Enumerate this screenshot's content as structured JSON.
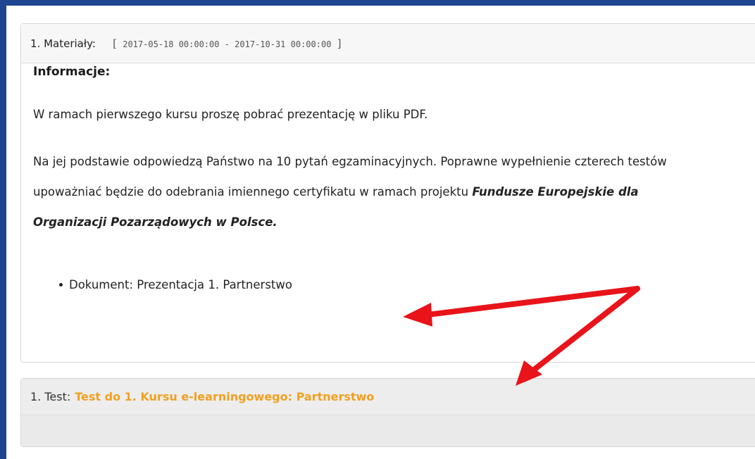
{
  "materials": {
    "header_label": "1. Materiały:",
    "bracket_open": "[",
    "date_range": "2017-05-18 00:00:00 - 2017-10-31 00:00:00",
    "bracket_close": "]",
    "info_title": "Informacje:",
    "paragraph1": "W ramach pierwszego kursu proszę pobrać prezentację w pliku PDF.",
    "paragraph2_text": "Na jej podstawie odpowiedzą Państwo na 10 pytań egzaminacyjnych. Poprawne wypełnienie czterech testów upoważniać będzie do odebrania imiennego certyfikatu w ramach projektu ",
    "paragraph2_bold": "Fundusze Europejskie dla Organizacji Pozarządowych w Polsce.",
    "document_prefix": "Dokument:",
    "document_link": "Prezentacja 1. Partnerstwo"
  },
  "test": {
    "label": "1. Test:",
    "link": "Test do 1. Kursu e-learningowego: Partnerstwo",
    "link_color": "#f0a020"
  },
  "annotations": {
    "arrow_color": "#e8141a"
  }
}
